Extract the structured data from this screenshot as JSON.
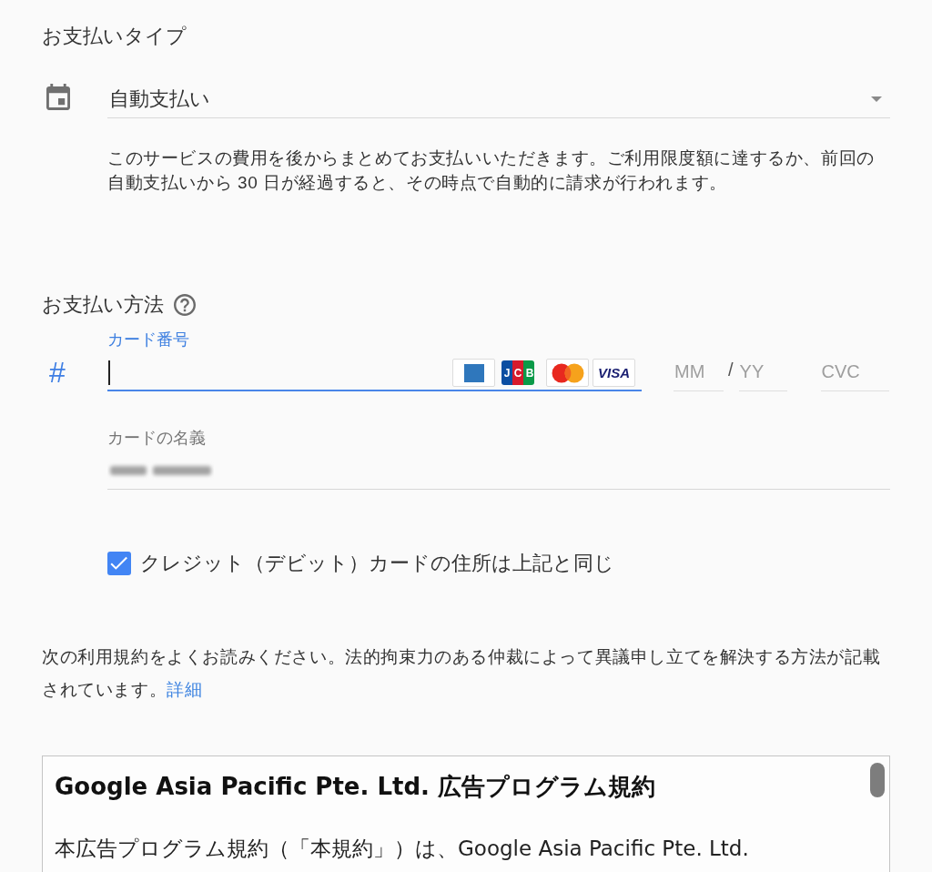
{
  "payment_type": {
    "heading": "お支払いタイプ",
    "dropdown": {
      "value": "自動支払い"
    },
    "description": "このサービスの費用を後からまとめてお支払いいただきます。ご利用限度額に達するか、前回の自動支払いから 30 日が経過すると、その時点で自動的に請求が行われます。"
  },
  "payment_method": {
    "heading": "お支払い方法",
    "card_number": {
      "symbol": "#",
      "label": "カード番号",
      "focused": true,
      "brands": [
        {
          "kind": "amex"
        },
        {
          "kind": "jcb",
          "label": "JCB"
        },
        {
          "kind": "mastercard"
        },
        {
          "kind": "visa",
          "label": "VISA"
        }
      ]
    },
    "expiry": {
      "month": {
        "placeholder": "MM"
      },
      "separator": "/",
      "year": {
        "placeholder": "YY"
      }
    },
    "cvc": {
      "placeholder": "CVC"
    },
    "cardholder_name": {
      "label": "カードの名義",
      "blurred": true
    },
    "same_address": {
      "label": "クレジット（デビット）カードの住所は上記と同じ",
      "checked": true
    }
  },
  "terms_notice": {
    "text": "次の利用規約をよくお読みください。法的拘束力のある仲裁によって異議申し立てを解決する方法が記載されています。",
    "link": "詳細"
  },
  "terms_box": {
    "title": "Google Asia Pacific Pte. Ltd. 広告プログラム規約",
    "paragraphs": [
      "本広告プログラム規約（「本規約」）は、Google Asia Pacific Pte. Ltd."
    ]
  }
}
